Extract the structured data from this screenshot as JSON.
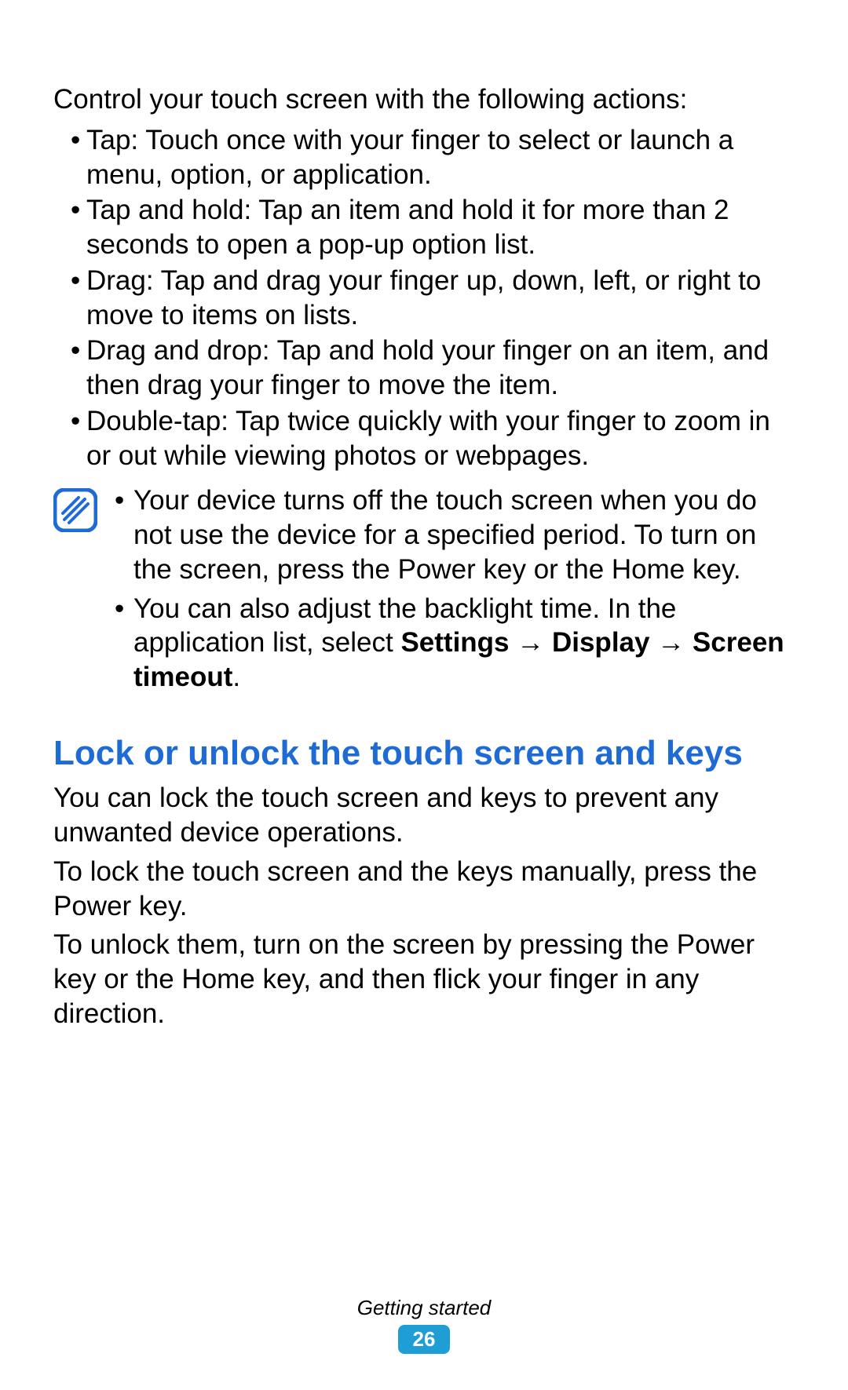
{
  "intro": "Control your touch screen with the following actions:",
  "actions": [
    "Tap: Touch once with your finger to select or launch a menu, option, or application.",
    "Tap and hold: Tap an item and hold it for more than 2 seconds to open a pop-up option list.",
    "Drag: Tap and drag your finger up, down, left, or right to move to items on lists.",
    "Drag and drop: Tap and hold your finger on an item, and then drag your finger to move the item.",
    "Double-tap: Tap twice quickly with your finger to zoom in or out while viewing photos or webpages."
  ],
  "note": {
    "items": [
      "Your device turns off the touch screen when you do not use the device for a specified period. To turn on the screen, press the Power key or the Home key."
    ],
    "item2_prefix": "You can also adjust the backlight time. In the application list, select ",
    "item2_bold": "Settings → Display → Screen timeout",
    "item2_suffix": "."
  },
  "section_heading": "Lock or unlock the touch screen and keys",
  "section_paragraphs": [
    "You can lock the touch screen and keys to prevent any unwanted device operations.",
    "To lock the touch screen and the keys manually, press the Power key.",
    "To unlock them, turn on the screen by pressing the Power key or the Home key, and then flick your finger in any direction."
  ],
  "footer": {
    "section": "Getting started",
    "page": "26"
  },
  "colors": {
    "heading_blue": "#1f6bd6",
    "badge_blue": "#1f9ed6"
  }
}
